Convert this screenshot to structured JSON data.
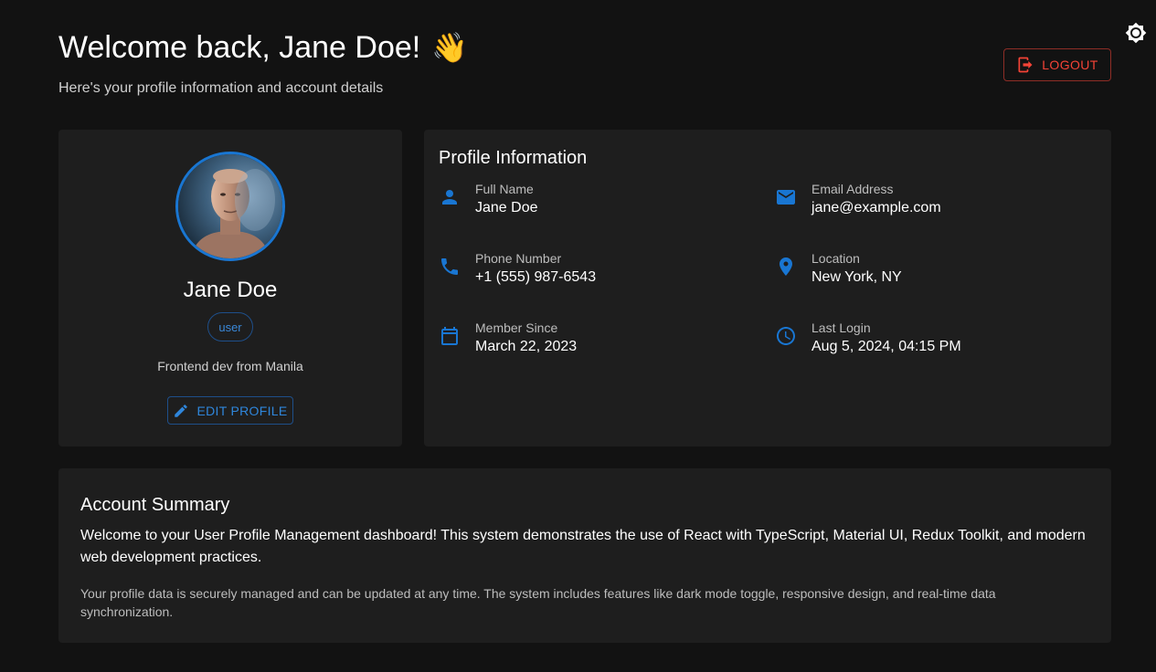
{
  "header": {
    "title": "Welcome back, Jane Doe!",
    "emoji": "👋",
    "subtitle": "Here's your profile information and account details",
    "logout_label": "LOGOUT"
  },
  "theme_toggle": {
    "icon": "brightness-icon"
  },
  "profile": {
    "name": "Jane Doe",
    "role": "user",
    "bio": "Frontend dev from Manila",
    "edit_label": "EDIT PROFILE"
  },
  "info": {
    "title": "Profile Information",
    "items": [
      {
        "label": "Full Name",
        "value": "Jane Doe",
        "icon": "person-icon"
      },
      {
        "label": "Email Address",
        "value": "jane@example.com",
        "icon": "email-icon"
      },
      {
        "label": "Phone Number",
        "value": "+1 (555) 987-6543",
        "icon": "phone-icon"
      },
      {
        "label": "Location",
        "value": "New York, NY",
        "icon": "location-icon"
      },
      {
        "label": "Member Since",
        "value": "March 22, 2023",
        "icon": "calendar-icon"
      },
      {
        "label": "Last Login",
        "value": "Aug 5, 2024, 04:15 PM",
        "icon": "clock-icon"
      }
    ]
  },
  "summary": {
    "title": "Account Summary",
    "main": "Welcome to your User Profile Management dashboard! This system demonstrates the use of React with TypeScript, Material UI, Redux Toolkit, and modern web development practices.",
    "sub": "Your profile data is securely managed and can be updated at any time. The system includes features like dark mode toggle, responsive design, and real-time data synchronization."
  },
  "colors": {
    "background": "#121212",
    "card": "#1e1e1e",
    "primary": "#1976d2",
    "error": "#f44336"
  }
}
